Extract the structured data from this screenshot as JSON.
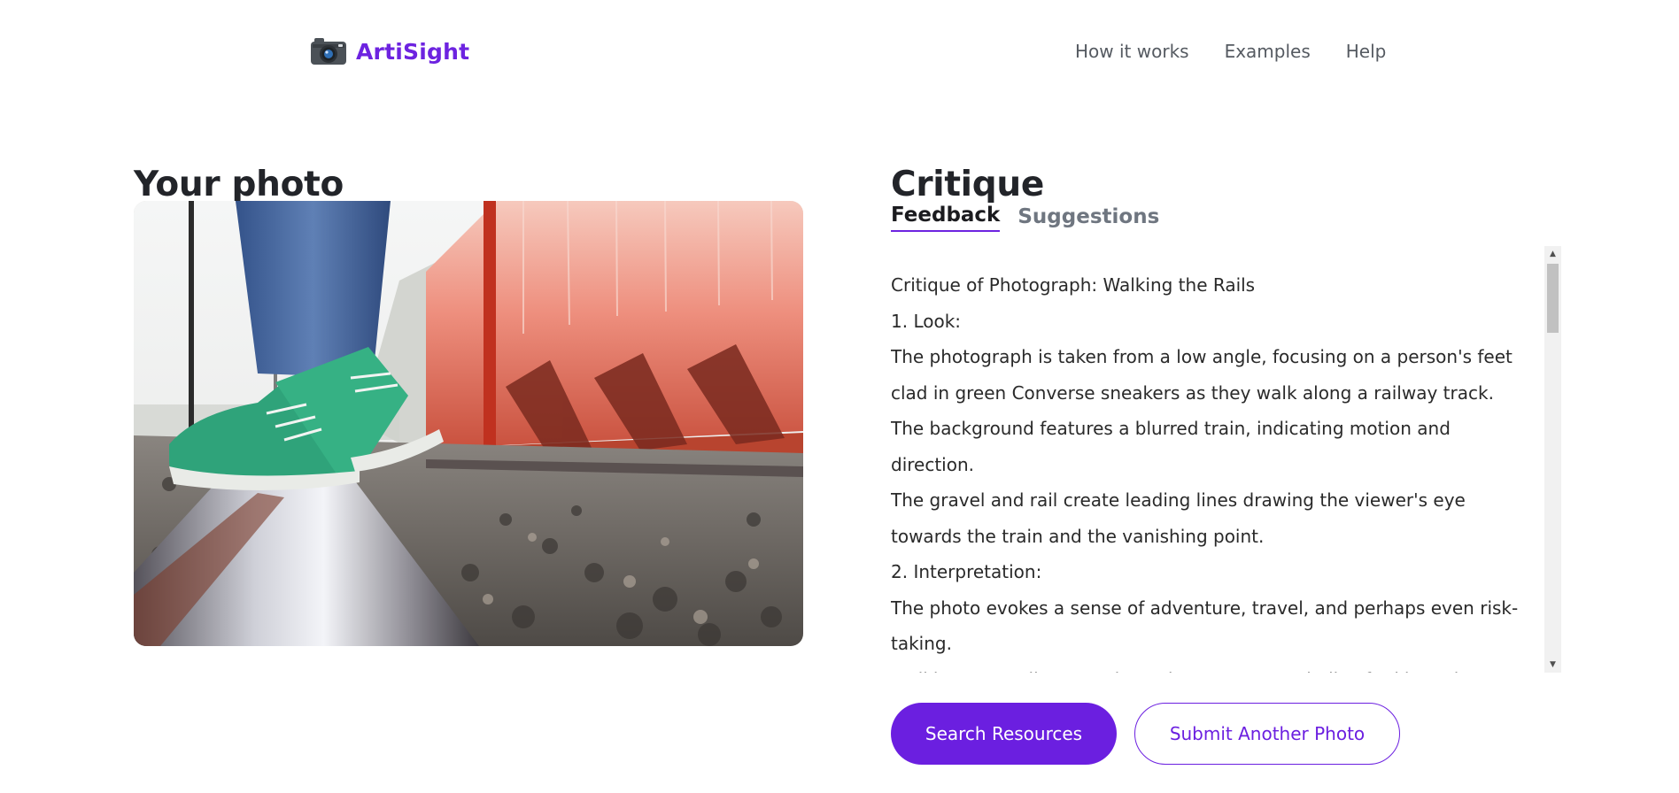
{
  "header": {
    "brand_name": "ArtiSight",
    "nav": [
      {
        "label": "How it works"
      },
      {
        "label": "Examples"
      },
      {
        "label": "Help"
      }
    ]
  },
  "photo_section": {
    "title": "Your photo",
    "image_alt": "Feet in green Converse sneakers walking on a railway track beside a red train"
  },
  "critique_section": {
    "title": "Critique",
    "tabs": [
      {
        "label": "Feedback",
        "active": true
      },
      {
        "label": "Suggestions",
        "active": false
      }
    ],
    "feedback_lines": [
      "Critique of Photograph: Walking the Rails",
      "1. Look:",
      "The photograph is taken from a low angle, focusing on a person's feet clad in green Converse sneakers as they walk along a railway track.",
      "The background features a blurred train, indicating motion and direction.",
      "The gravel and rail create leading lines drawing the viewer's eye towards the train and the vanishing point.",
      "2. Interpretation:",
      "The photo evokes a sense of adventure, travel, and perhaps even risk-taking.",
      "Walking on a railway track can be seen as symbolic of taking a less-traveled path or embarking on a journey into the unknown."
    ]
  },
  "actions": {
    "primary_label": "Search Resources",
    "secondary_label": "Submit Another Photo"
  },
  "colors": {
    "accent": "#6b1fe0",
    "brand": "#6d23e0",
    "text": "#2a2a2a",
    "muted": "#6f7680"
  }
}
